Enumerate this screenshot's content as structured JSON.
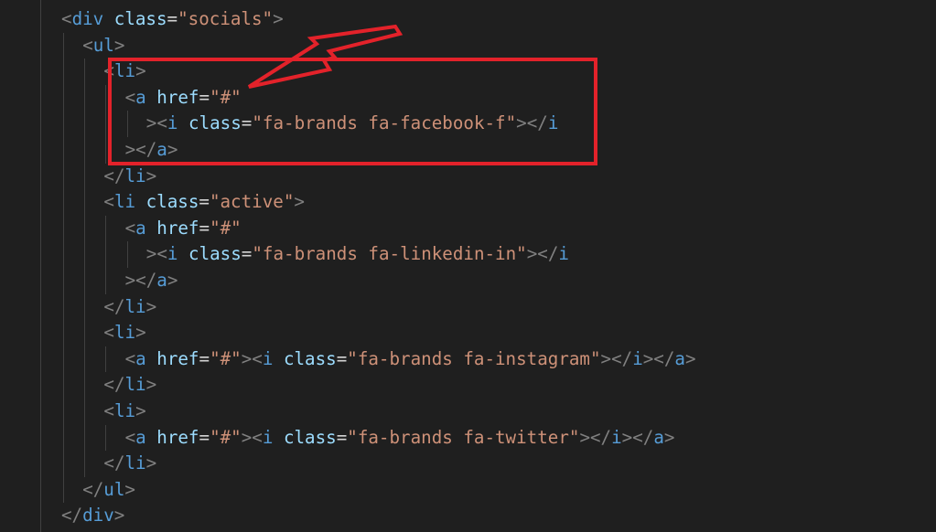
{
  "editor": {
    "lines": [
      {
        "indent": 0,
        "tokens": [
          {
            "t": "<",
            "c": "punct"
          },
          {
            "t": "div",
            "c": "tag"
          },
          {
            "t": " ",
            "c": "eq"
          },
          {
            "t": "class",
            "c": "attr"
          },
          {
            "t": "=",
            "c": "eq"
          },
          {
            "t": "\"socials\"",
            "c": "str"
          },
          {
            "t": ">",
            "c": "punct"
          }
        ]
      },
      {
        "indent": 1,
        "tokens": [
          {
            "t": "<",
            "c": "punct"
          },
          {
            "t": "ul",
            "c": "tag"
          },
          {
            "t": ">",
            "c": "punct"
          }
        ]
      },
      {
        "indent": 2,
        "tokens": [
          {
            "t": "<",
            "c": "punct"
          },
          {
            "t": "li",
            "c": "tag"
          },
          {
            "t": ">",
            "c": "punct"
          }
        ]
      },
      {
        "indent": 3,
        "tokens": [
          {
            "t": "<",
            "c": "punct"
          },
          {
            "t": "a",
            "c": "tag"
          },
          {
            "t": " ",
            "c": "eq"
          },
          {
            "t": "href",
            "c": "attr"
          },
          {
            "t": "=",
            "c": "eq"
          },
          {
            "t": "\"#\"",
            "c": "str"
          }
        ]
      },
      {
        "indent": 4,
        "tokens": [
          {
            "t": "><",
            "c": "punct"
          },
          {
            "t": "i",
            "c": "tag"
          },
          {
            "t": " ",
            "c": "eq"
          },
          {
            "t": "class",
            "c": "attr"
          },
          {
            "t": "=",
            "c": "eq"
          },
          {
            "t": "\"fa-brands fa-facebook-f\"",
            "c": "str"
          },
          {
            "t": "></",
            "c": "punct"
          },
          {
            "t": "i",
            "c": "tag"
          }
        ]
      },
      {
        "indent": 3,
        "tokens": [
          {
            "t": "></",
            "c": "punct"
          },
          {
            "t": "a",
            "c": "tag"
          },
          {
            "t": ">",
            "c": "punct"
          }
        ]
      },
      {
        "indent": 2,
        "tokens": [
          {
            "t": "</",
            "c": "punct"
          },
          {
            "t": "li",
            "c": "tag"
          },
          {
            "t": ">",
            "c": "punct"
          }
        ]
      },
      {
        "indent": 2,
        "tokens": [
          {
            "t": "<",
            "c": "punct"
          },
          {
            "t": "li",
            "c": "tag"
          },
          {
            "t": " ",
            "c": "eq"
          },
          {
            "t": "class",
            "c": "attr"
          },
          {
            "t": "=",
            "c": "eq"
          },
          {
            "t": "\"active\"",
            "c": "str"
          },
          {
            "t": ">",
            "c": "punct"
          }
        ]
      },
      {
        "indent": 3,
        "tokens": [
          {
            "t": "<",
            "c": "punct"
          },
          {
            "t": "a",
            "c": "tag"
          },
          {
            "t": " ",
            "c": "eq"
          },
          {
            "t": "href",
            "c": "attr"
          },
          {
            "t": "=",
            "c": "eq"
          },
          {
            "t": "\"#\"",
            "c": "str"
          }
        ]
      },
      {
        "indent": 4,
        "tokens": [
          {
            "t": "><",
            "c": "punct"
          },
          {
            "t": "i",
            "c": "tag"
          },
          {
            "t": " ",
            "c": "eq"
          },
          {
            "t": "class",
            "c": "attr"
          },
          {
            "t": "=",
            "c": "eq"
          },
          {
            "t": "\"fa-brands fa-linkedin-in\"",
            "c": "str"
          },
          {
            "t": "></",
            "c": "punct"
          },
          {
            "t": "i",
            "c": "tag"
          }
        ]
      },
      {
        "indent": 3,
        "tokens": [
          {
            "t": "></",
            "c": "punct"
          },
          {
            "t": "a",
            "c": "tag"
          },
          {
            "t": ">",
            "c": "punct"
          }
        ]
      },
      {
        "indent": 2,
        "tokens": [
          {
            "t": "</",
            "c": "punct"
          },
          {
            "t": "li",
            "c": "tag"
          },
          {
            "t": ">",
            "c": "punct"
          }
        ]
      },
      {
        "indent": 2,
        "tokens": [
          {
            "t": "<",
            "c": "punct"
          },
          {
            "t": "li",
            "c": "tag"
          },
          {
            "t": ">",
            "c": "punct"
          }
        ]
      },
      {
        "indent": 3,
        "tokens": [
          {
            "t": "<",
            "c": "punct"
          },
          {
            "t": "a",
            "c": "tag"
          },
          {
            "t": " ",
            "c": "eq"
          },
          {
            "t": "href",
            "c": "attr"
          },
          {
            "t": "=",
            "c": "eq"
          },
          {
            "t": "\"#\"",
            "c": "str"
          },
          {
            "t": "><",
            "c": "punct"
          },
          {
            "t": "i",
            "c": "tag"
          },
          {
            "t": " ",
            "c": "eq"
          },
          {
            "t": "class",
            "c": "attr"
          },
          {
            "t": "=",
            "c": "eq"
          },
          {
            "t": "\"fa-brands fa-instagram\"",
            "c": "str"
          },
          {
            "t": "></",
            "c": "punct"
          },
          {
            "t": "i",
            "c": "tag"
          },
          {
            "t": "></",
            "c": "punct"
          },
          {
            "t": "a",
            "c": "tag"
          },
          {
            "t": ">",
            "c": "punct"
          }
        ]
      },
      {
        "indent": 2,
        "tokens": [
          {
            "t": "</",
            "c": "punct"
          },
          {
            "t": "li",
            "c": "tag"
          },
          {
            "t": ">",
            "c": "punct"
          }
        ]
      },
      {
        "indent": 2,
        "tokens": [
          {
            "t": "<",
            "c": "punct"
          },
          {
            "t": "li",
            "c": "tag"
          },
          {
            "t": ">",
            "c": "punct"
          }
        ]
      },
      {
        "indent": 3,
        "tokens": [
          {
            "t": "<",
            "c": "punct"
          },
          {
            "t": "a",
            "c": "tag"
          },
          {
            "t": " ",
            "c": "eq"
          },
          {
            "t": "href",
            "c": "attr"
          },
          {
            "t": "=",
            "c": "eq"
          },
          {
            "t": "\"#\"",
            "c": "str"
          },
          {
            "t": "><",
            "c": "punct"
          },
          {
            "t": "i",
            "c": "tag"
          },
          {
            "t": " ",
            "c": "eq"
          },
          {
            "t": "class",
            "c": "attr"
          },
          {
            "t": "=",
            "c": "eq"
          },
          {
            "t": "\"fa-brands fa-twitter\"",
            "c": "str"
          },
          {
            "t": "></",
            "c": "punct"
          },
          {
            "t": "i",
            "c": "tag"
          },
          {
            "t": "></",
            "c": "punct"
          },
          {
            "t": "a",
            "c": "tag"
          },
          {
            "t": ">",
            "c": "punct"
          }
        ]
      },
      {
        "indent": 2,
        "tokens": [
          {
            "t": "</",
            "c": "punct"
          },
          {
            "t": "li",
            "c": "tag"
          },
          {
            "t": ">",
            "c": "punct"
          }
        ]
      },
      {
        "indent": 1,
        "tokens": [
          {
            "t": "</",
            "c": "punct"
          },
          {
            "t": "ul",
            "c": "tag"
          },
          {
            "t": ">",
            "c": "punct"
          }
        ]
      },
      {
        "indent": 0,
        "tokens": [
          {
            "t": "</",
            "c": "punct"
          },
          {
            "t": "div",
            "c": "tag"
          },
          {
            "t": ">",
            "c": "punct"
          }
        ]
      }
    ]
  },
  "annotation": {
    "box_color": "#e3222a",
    "arrow_color": "#e3222a",
    "shapes": [
      "highlight-box",
      "arrow"
    ]
  },
  "colors": {
    "background": "#1f1f1f",
    "punctuation": "#808080",
    "tag": "#569cd6",
    "attribute": "#9cdcfe",
    "string": "#ce9178",
    "equals": "#d4d4d4"
  }
}
